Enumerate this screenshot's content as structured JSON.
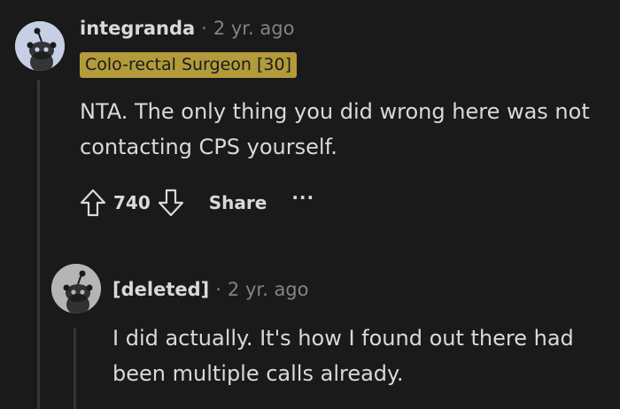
{
  "comment": {
    "author": "integranda",
    "separator": "·",
    "time": "2 yr. ago",
    "flair": "Colo-rectal Surgeon [30]",
    "body": "NTA. The only thing you did wrong here was not contacting CPS yourself.",
    "score": "740",
    "share_label": "Share",
    "more_label": "···",
    "icons": {
      "upvote": "upvote-arrow-icon",
      "downvote": "downvote-arrow-icon",
      "avatar": "snoo-avatar-icon"
    },
    "colors": {
      "flair_bg": "#b39b3b",
      "background": "#1a1a1b",
      "meta": "#818384"
    }
  },
  "reply": {
    "author": "[deleted]",
    "separator": "·",
    "time": "2 yr. ago",
    "body": "I did actually. It's how I found out there had been multiple calls already."
  }
}
